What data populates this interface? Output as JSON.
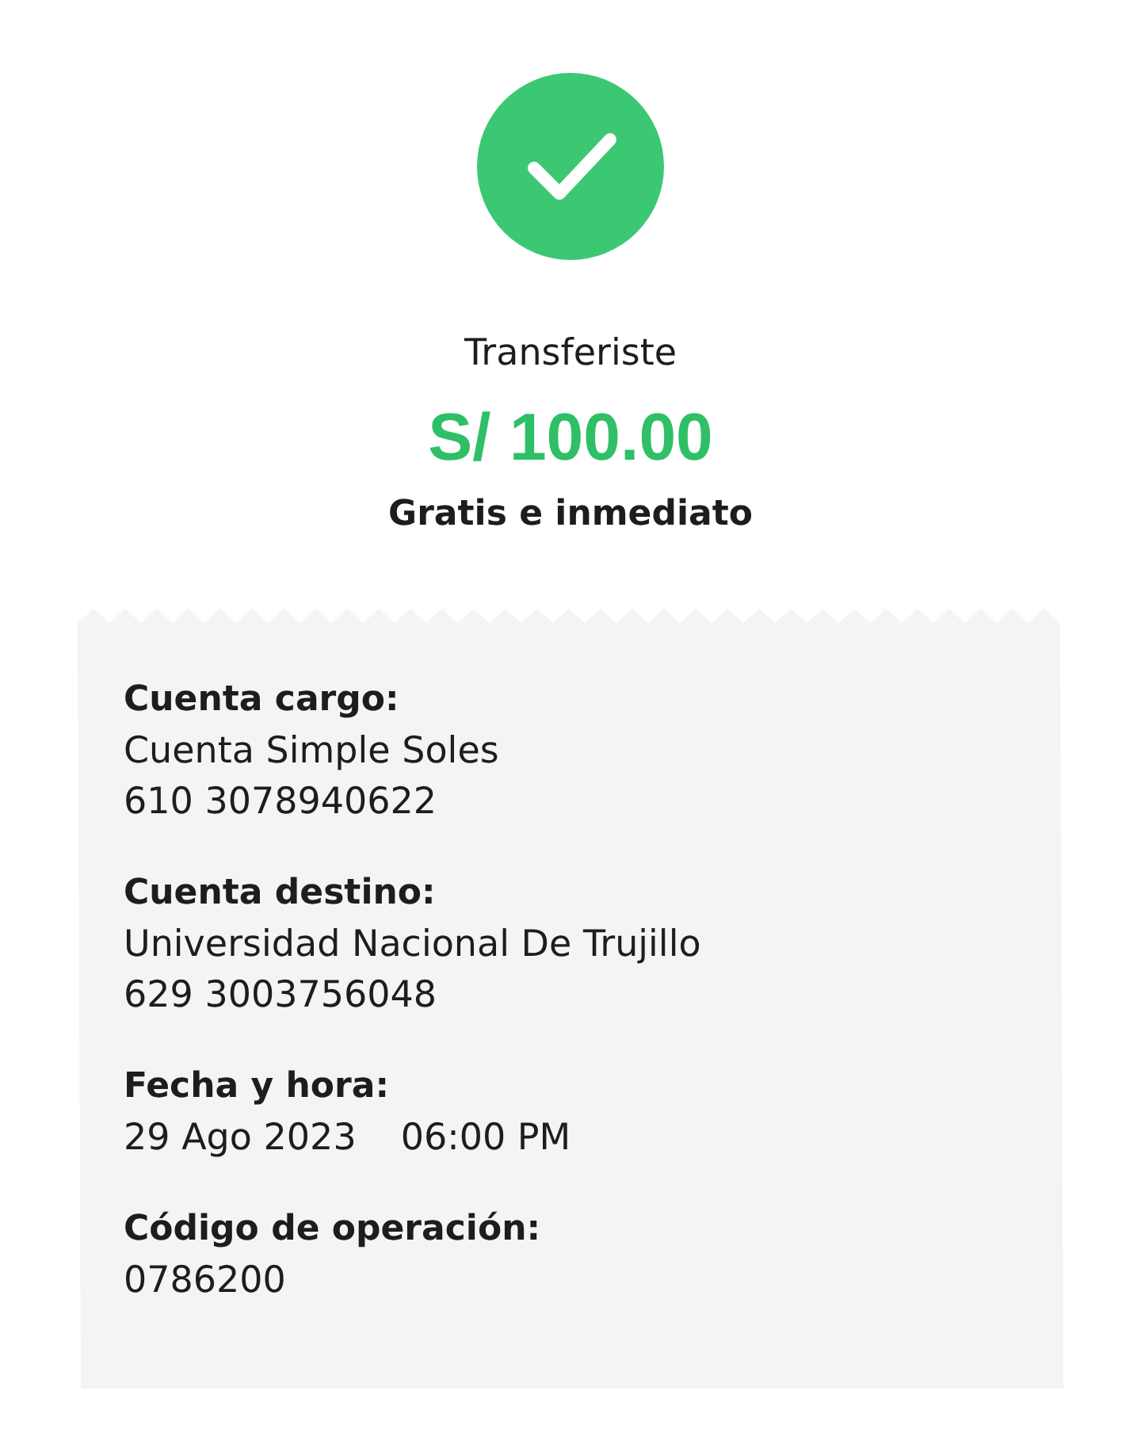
{
  "status": {
    "title": "Transferiste",
    "amount": "S/ 100.00",
    "note": "Gratis e inmediato"
  },
  "details": [
    {
      "kind": "stacked",
      "label": "Cuenta cargo:",
      "values": [
        "Cuenta Simple Soles",
        "610 3078940622"
      ]
    },
    {
      "kind": "stacked",
      "label": "Cuenta destino:",
      "values": [
        "Universidad Nacional De Trujillo",
        "629 3003756048"
      ]
    },
    {
      "kind": "inline",
      "label": "Fecha y hora:",
      "values": [
        "29 Ago 2023",
        "06:00 PM"
      ]
    },
    {
      "kind": "stacked",
      "label": "Código de operación:",
      "values": [
        "0786200"
      ]
    }
  ]
}
